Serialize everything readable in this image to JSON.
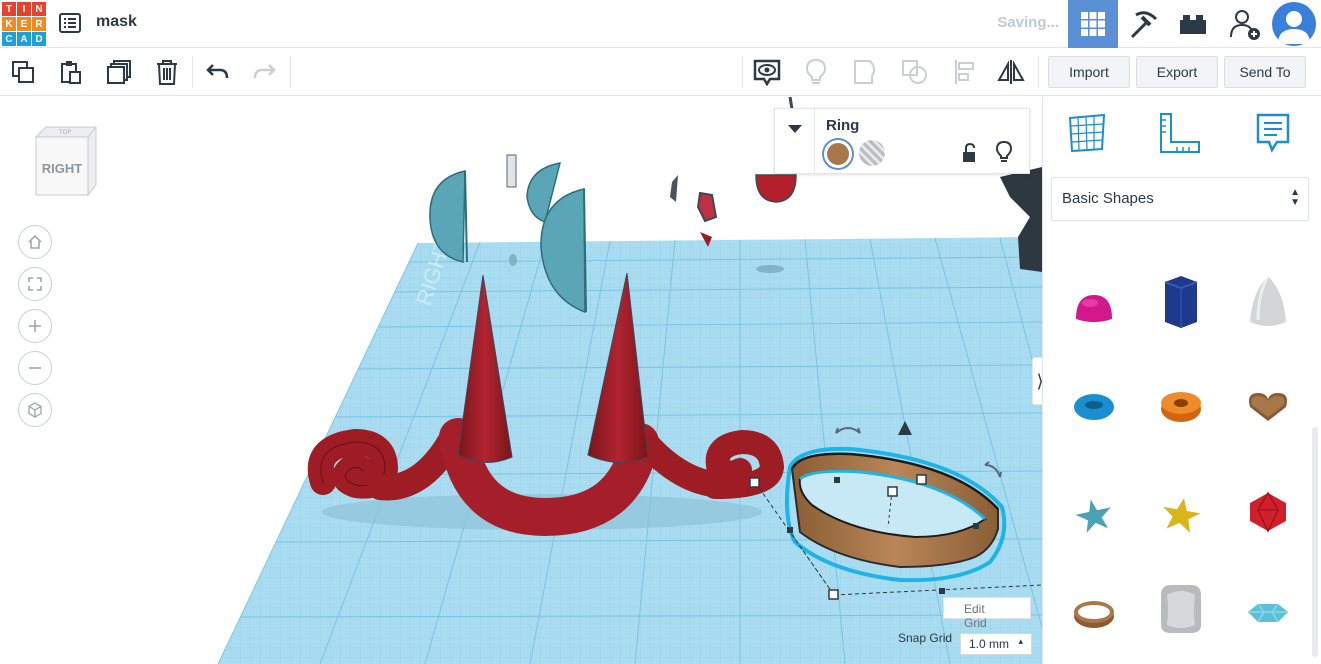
{
  "app": {
    "logo_letters": [
      "T",
      "I",
      "N",
      "K",
      "E",
      "R",
      "C",
      "A",
      "D"
    ],
    "logo_colors": [
      "#e8412c",
      "#e8412c",
      "#e8412c",
      "#f18a21",
      "#f18a21",
      "#f18a21",
      "#1c9ee0",
      "#1c9ee0",
      "#1c9ee0"
    ],
    "document_title": "mask",
    "save_status": "Saving..."
  },
  "topnav": {
    "icons": [
      "3d-design-grid-icon",
      "codeblocks-pickaxe-icon",
      "bricks-icon",
      "invite-user-icon",
      "user-avatar"
    ],
    "active_color": "#5b8fd6"
  },
  "toolbar": {
    "import_label": "Import",
    "export_label": "Export",
    "sendto_label": "Send To"
  },
  "inspector": {
    "shape_name": "Ring",
    "solid_color": "#a9784a"
  },
  "viewcube": {
    "face_label": "RIGHT"
  },
  "grid": {
    "edit_grid_label": "Edit Grid",
    "snap_grid_label": "Snap Grid",
    "snap_grid_value": "1.0 mm"
  },
  "shapes_panel": {
    "category": "Basic Shapes",
    "shapes": [
      "half-sphere",
      "polygon-prism",
      "paraboloid",
      "torus",
      "tube",
      "heart",
      "star",
      "star-gold",
      "icosahedron",
      "ring",
      "rounded-cube",
      "gem"
    ]
  },
  "colors": {
    "workplane": "#a9dcf0",
    "grid_line": "#7cc4e2",
    "horn_red": "#9e1c24",
    "teal": "#5aa6b6",
    "ring_brown": "#a9784a",
    "selection": "#1fb4e8"
  }
}
